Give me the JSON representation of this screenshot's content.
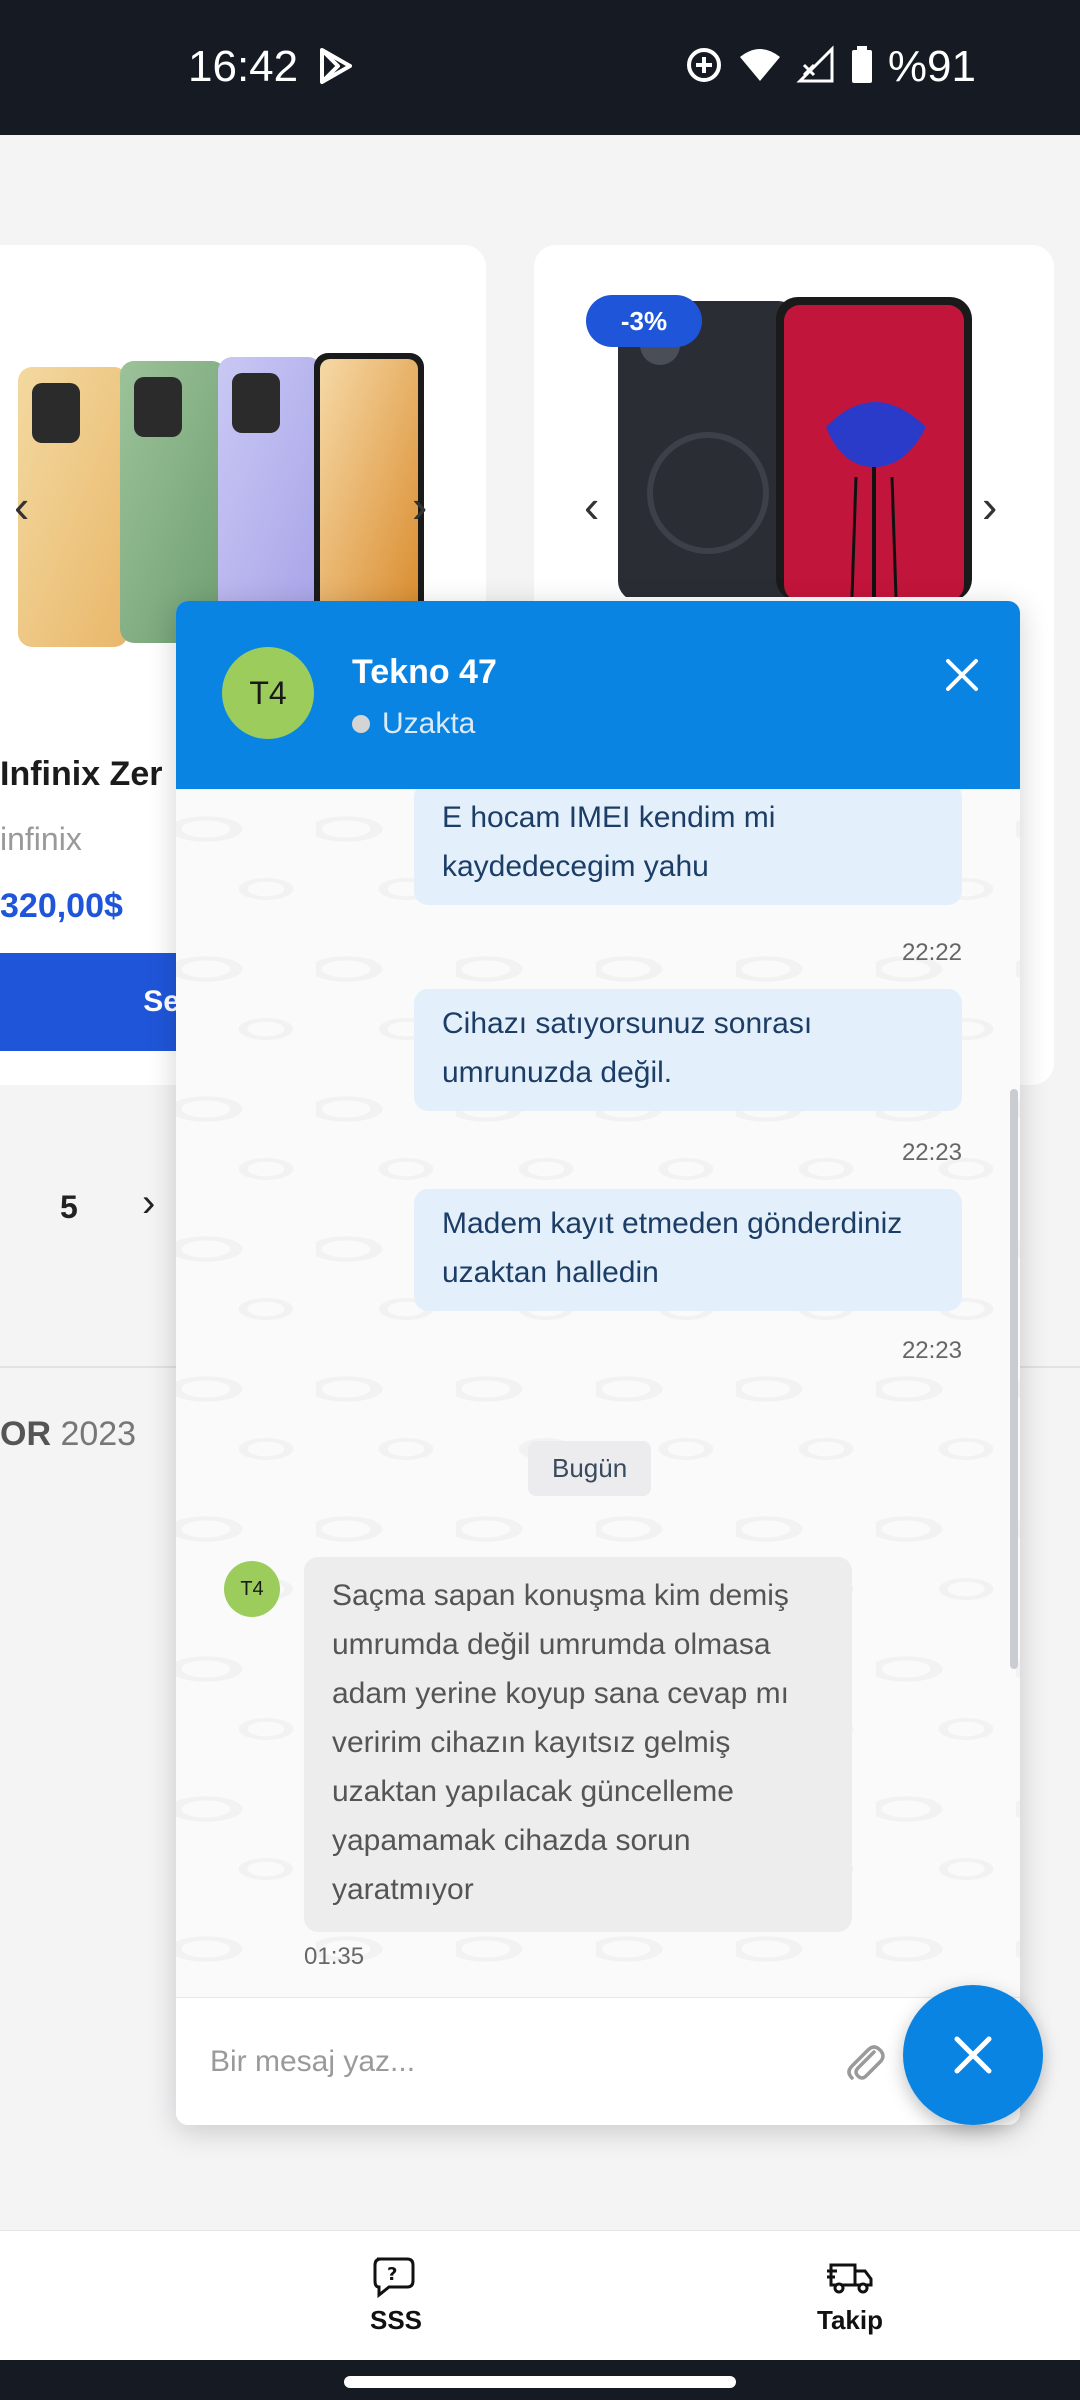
{
  "status_bar": {
    "time": "16:42",
    "battery": "%91"
  },
  "products": [
    {
      "name": "Infinix Zer",
      "brand": "infinix",
      "price": "320,00$",
      "button_label": "Se"
    },
    {
      "discount_badge": "-3%"
    }
  ],
  "pagination": {
    "page": "5"
  },
  "footer": {
    "brand_suffix": "OR",
    "year": "2023"
  },
  "chat": {
    "avatar_initials": "T4",
    "title": "Tekno 47",
    "status": "Uzakta",
    "messages_out": [
      {
        "text": "E hocam IMEI kendim mi kaydedecegim yahu",
        "time": "22:22"
      },
      {
        "text": "Cihazı satıyorsunuz sonrası umrunuzda değil.",
        "time": "22:23"
      },
      {
        "text": "Madem kayıt etmeden gönderdiniz uzaktan halledin",
        "time": "22:23"
      }
    ],
    "day_separator": "Bugün",
    "message_in": {
      "avatar_initials": "T4",
      "text": "Saçma sapan konuşma kim demiş umrumda değil umrumda olmasa adam yerine koyup sana cevap mı veririm cihazın kayıtsız gelmiş uzaktan yapılacak güncelleme yapamamak cihazda sorun yaratmıyor",
      "time": "01:35"
    },
    "input_placeholder": "Bir mesaj yaz..."
  },
  "bottom_nav": {
    "items": [
      {
        "label": "SSS",
        "icon": "faq-chat-icon"
      },
      {
        "label": "Takip",
        "icon": "delivery-truck-icon"
      }
    ]
  },
  "colors": {
    "chat_header": "#0a84e3",
    "brand_blue": "#1f56d9",
    "avatar_green": "#9ccd5c",
    "outgoing_bubble": "#e3f0fb",
    "incoming_bubble": "#ededee"
  }
}
